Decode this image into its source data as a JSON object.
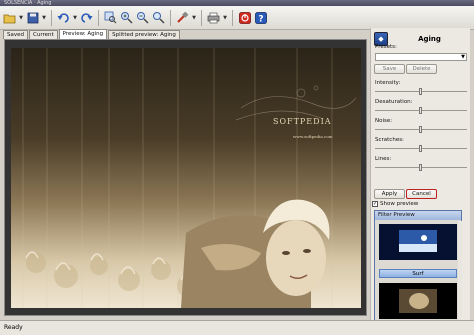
{
  "window": {
    "title": "SOLSENCIA · Aging"
  },
  "toolbar": {
    "icons": [
      "open-icon",
      "save-icon",
      "undo-icon",
      "zoom-fit-icon",
      "zoom-in-icon",
      "zoom-out-icon",
      "zoom-actual-icon",
      "tools-icon",
      "print-icon",
      "stop-icon",
      "help-icon"
    ]
  },
  "tabs": [
    {
      "label": "Saved"
    },
    {
      "label": "Current"
    },
    {
      "label": "Preview: Aging",
      "active": true
    },
    {
      "label": "Splitted preview: Aging"
    }
  ],
  "image": {
    "brand": "SOFTPEDIA",
    "url": "www.softpedia.com"
  },
  "panel": {
    "title": "Aging",
    "presets_label": "Presets:",
    "presets_value": "",
    "save_label": "Save",
    "delete_label": "Delete",
    "sliders": [
      {
        "label": "Intensity:",
        "value": 0.5
      },
      {
        "label": "Desaturation:",
        "value": 0.5
      },
      {
        "label": "Noise:",
        "value": 0.5
      },
      {
        "label": "Scratches:",
        "value": 0.5
      },
      {
        "label": "Lines:",
        "value": 0.5
      }
    ],
    "apply_label": "Apply",
    "cancel_label": "Cancel",
    "show_preview_label": "Show preview",
    "show_preview_checked": true
  },
  "filter_preview": {
    "title": "Filter Preview",
    "items": [
      {
        "label": "Surf"
      }
    ]
  },
  "status": {
    "text": "Ready"
  },
  "colors": {
    "accent": "#2e5fa8",
    "sepia_dark": "#2b2418",
    "sepia_light": "#efe6d2"
  }
}
